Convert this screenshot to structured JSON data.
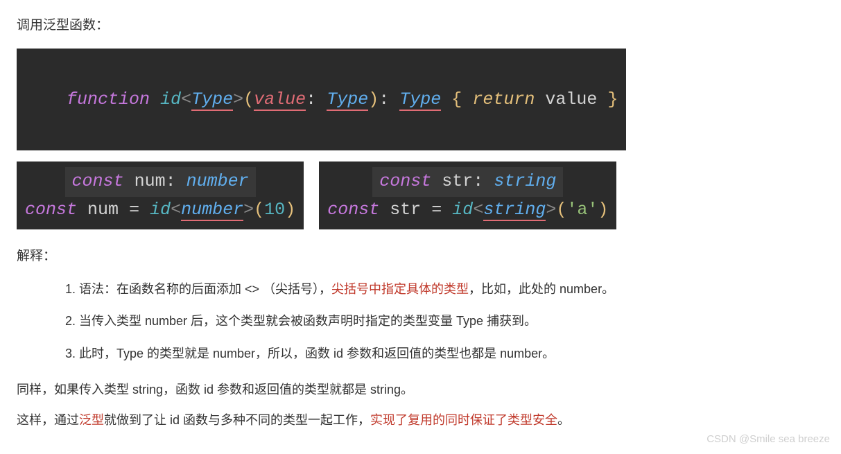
{
  "heading": "调用泛型函数：",
  "code_full": {
    "kw_function": "function",
    "fn_name": "id",
    "angle_open": "<",
    "type_Type": "Type",
    "angle_close": ">",
    "paren_open": "(",
    "param_name": "value",
    "colon1": ":",
    "param_type": "Type",
    "paren_close": ")",
    "colon2": ":",
    "return_type": "Type",
    "brace_open": "{",
    "kw_return": "return",
    "ret_value": "value",
    "brace_close": "}"
  },
  "code_left": {
    "hint_kw": "const",
    "hint_name": "num",
    "hint_colon": ":",
    "hint_type": "number",
    "kw_const": "const",
    "var_name": "num",
    "eq": "=",
    "fn_call": "id",
    "angle_open": "<",
    "type_arg": "number",
    "angle_close": ">",
    "paren_open": "(",
    "arg_value": "10",
    "paren_close": ")"
  },
  "code_right": {
    "hint_kw": "const",
    "hint_name": "str",
    "hint_colon": ":",
    "hint_type": "string",
    "kw_const": "const",
    "var_name": "str",
    "eq": "=",
    "fn_call": "id",
    "angle_open": "<",
    "type_arg": "string",
    "angle_close": ">",
    "paren_open": "(",
    "arg_value": "'a'",
    "paren_close": ")"
  },
  "explain_heading": "解释：",
  "list": {
    "item1_a": "语法：在函数名称的后面添加 <> （尖括号），",
    "item1_red": "尖括号中指定具体的类型",
    "item1_b": "，比如，此处的 number。",
    "item2": "当传入类型 number 后，这个类型就会被函数声明时指定的类型变量 Type 捕获到。",
    "item3": "此时，Type 的类型就是 number，所以，函数 id 参数和返回值的类型也都是 number。"
  },
  "para1": "同样，如果传入类型 string，函数 id 参数和返回值的类型就都是 string。",
  "para2_a": "这样，通过",
  "para2_red1": "泛型",
  "para2_b": "就做到了让 id 函数与多种不同的类型一起工作，",
  "para2_red2": "实现了复用的同时保证了类型安全",
  "para2_c": "。",
  "watermark": "CSDN @Smile sea breeze"
}
